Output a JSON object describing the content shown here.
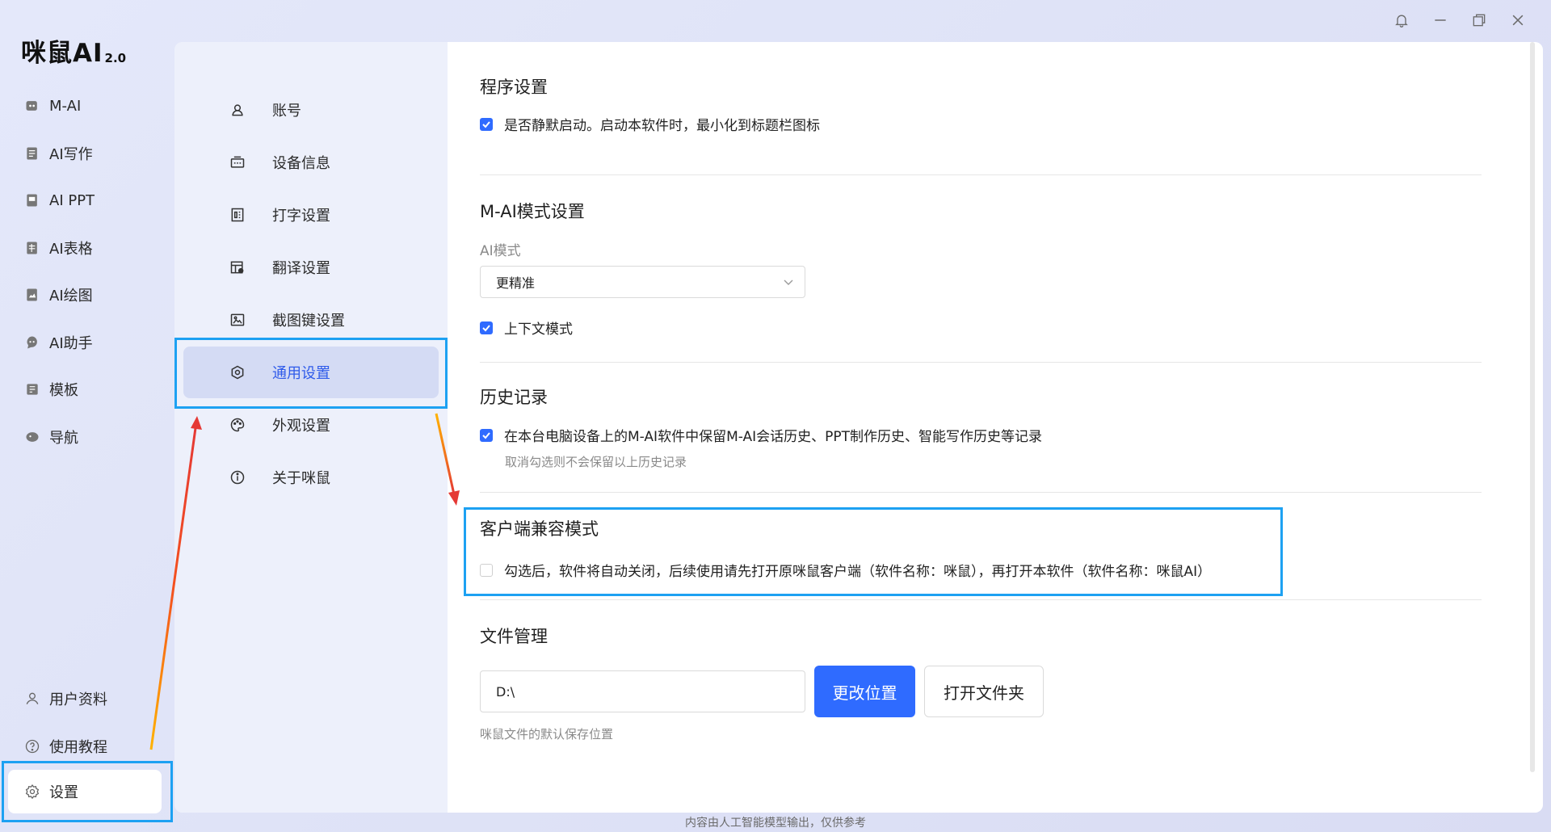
{
  "app": {
    "brand": "咪鼠AI",
    "version": "2.0"
  },
  "sidebar": {
    "items": [
      {
        "label": "M-AI",
        "icon": "robot-icon"
      },
      {
        "label": "AI写作",
        "icon": "write-icon"
      },
      {
        "label": "AI PPT",
        "icon": "ppt-icon"
      },
      {
        "label": "AI表格",
        "icon": "table-icon"
      },
      {
        "label": "AI绘图",
        "icon": "paint-icon"
      },
      {
        "label": "AI助手",
        "icon": "assistant-icon"
      },
      {
        "label": "模板",
        "icon": "template-icon"
      },
      {
        "label": "导航",
        "icon": "navigation-icon"
      }
    ],
    "bottom": [
      {
        "label": "用户资料",
        "icon": "user-icon"
      },
      {
        "label": "使用教程",
        "icon": "help-icon"
      },
      {
        "label": "设置",
        "icon": "gear-icon"
      }
    ]
  },
  "subnav": {
    "items": [
      {
        "label": "账号",
        "icon": "account-icon"
      },
      {
        "label": "设备信息",
        "icon": "device-icon"
      },
      {
        "label": "打字设置",
        "icon": "typing-icon"
      },
      {
        "label": "翻译设置",
        "icon": "translate-icon"
      },
      {
        "label": "截图键设置",
        "icon": "screenshot-icon"
      },
      {
        "label": "通用设置",
        "icon": "general-icon"
      },
      {
        "label": "外观设置",
        "icon": "palette-icon"
      },
      {
        "label": "关于咪鼠",
        "icon": "info-icon"
      }
    ],
    "active": "通用设置"
  },
  "settings": {
    "program": {
      "title": "程序设置",
      "silent_start": "是否静默启动。启动本软件时，最小化到标题栏图标",
      "silent_start_checked": true
    },
    "mai": {
      "title": "M-AI模式设置",
      "mode_label": "AI模式",
      "mode_value": "更精准",
      "context_mode": "上下文模式",
      "context_checked": true
    },
    "history": {
      "title": "历史记录",
      "keep": "在本台电脑设备上的M-AI软件中保留M-AI会话历史、PPT制作历史、智能写作历史等记录",
      "keep_checked": true,
      "hint": "取消勾选则不会保留以上历史记录"
    },
    "compat": {
      "title": "客户端兼容模式",
      "option": "勾选后，软件将自动关闭，后续使用请先打开原咪鼠客户端（软件名称：咪鼠），再打开本软件（软件名称：咪鼠AI）",
      "checked": false
    },
    "files": {
      "title": "文件管理",
      "path": "D:\\",
      "change_btn": "更改位置",
      "open_btn": "打开文件夹",
      "hint": "咪鼠文件的默认保存位置"
    }
  },
  "footer": "内容由人工智能模型输出，仅供参考",
  "colors": {
    "accent": "#2f6bff",
    "highlight": "#1da1f2",
    "arrow": "#e53935"
  }
}
